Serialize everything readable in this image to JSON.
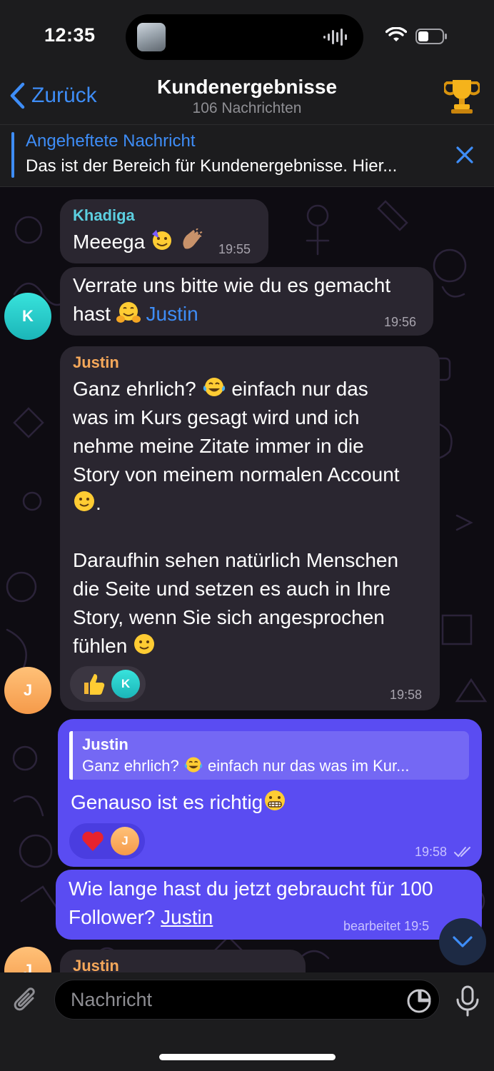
{
  "status": {
    "time": "12:35"
  },
  "header": {
    "back_label": "Zurück",
    "title": "Kundenergebnisse",
    "subtitle": "106 Nachrichten"
  },
  "pinned": {
    "title": "Angeheftete Nachricht",
    "text": "Das ist der Bereich für Kundenergebnisse. Hier..."
  },
  "messages": [
    {
      "sender": "Khadiga",
      "text": "Meeega",
      "time": "19:55",
      "avatar": "K"
    },
    {
      "text": "Verrate uns bitte wie du es gemacht hast",
      "mention": "Justin",
      "time": "19:56"
    },
    {
      "sender": "Justin",
      "lines": [
        "Ganz ehrlich?",
        "einfach nur das",
        "was im Kurs gesagt wird und ich",
        "nehme meine Zitate immer in die",
        "Story von meinem normalen Account",
        ".",
        "Daraufhin sehen natürlich Menschen",
        "die Seite und setzen es auch in Ihre",
        "Story, wenn Sie sich angesprochen",
        "fühlen"
      ],
      "reaction_avatar": "K",
      "time": "19:58",
      "avatar": "J"
    },
    {
      "reply_sender": "Justin",
      "reply_pre": "Ganz ehrlich?",
      "reply_post": "einfach nur das was im Kur...",
      "text": "Genauso ist es richtig",
      "reaction_avatar": "J",
      "time": "19:58"
    },
    {
      "text": "Wie lange hast du jetzt gebraucht für 100",
      "text2": "Follower?",
      "mention": "Justin",
      "time": "bearbeitet 19:5"
    },
    {
      "sender": "Justin",
      "avatar": "J"
    }
  ],
  "input": {
    "placeholder": "Nachricht"
  },
  "colors": {
    "accent": "#3e8df7",
    "outgoing": "#5a4cf2",
    "incoming": "#2a2630"
  }
}
